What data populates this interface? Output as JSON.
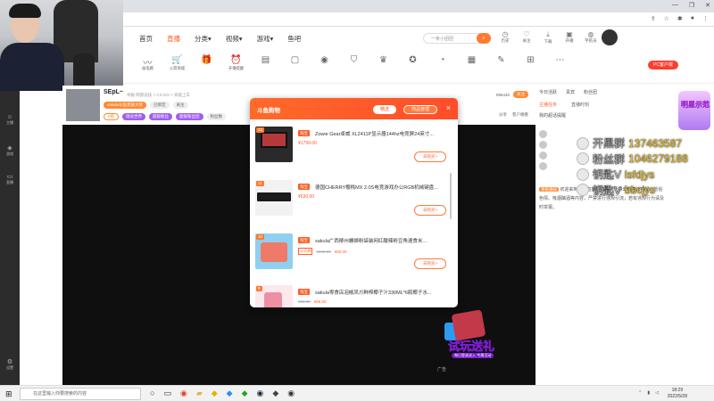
{
  "site_nav": {
    "items": [
      "首页",
      "直播",
      "分类▾",
      "视频▾",
      "游戏▾",
      "鱼吧"
    ],
    "active_index": 1,
    "search_placeholder": "一条小团团",
    "icons": [
      "历史",
      "关注",
      "下载",
      "开播",
      "宇航员"
    ]
  },
  "toolbar": {
    "tools": [
      "画电路",
      "火箭商城",
      "",
      "开播提醒",
      "",
      "",
      "",
      "",
      "",
      "",
      "",
      "",
      "",
      "",
      "",
      ""
    ],
    "pc_button": "PC客户端"
  },
  "streamer": {
    "name": "SEpL~",
    "crumbs": "举报  网游竞技 > CS:GO > 高能上车",
    "tags": [
      "sakula斗鱼贵族大奖",
      "已绑定",
      "关注"
    ],
    "chips": [
      "6级",
      "瑞龙世界",
      "超级粉丝",
      "超级粉丝团",
      "粉丝数"
    ],
    "right_info": [
      "896446",
      "关注"
    ],
    "right_actions": [
      "分享",
      "客户端看"
    ]
  },
  "modal": {
    "logo": "斗鱼购物",
    "btn_hot": "精选",
    "btn_manage": "商品管理",
    "close": "×",
    "items": [
      {
        "num": "12",
        "tag": "淘宝",
        "title": "Zowie Gear卓威 XL2411P显示器144hz电竞屏24英寸...",
        "price": "¥1799.00",
        "buy": "去购买>"
      },
      {
        "num": "11",
        "tag": "淘宝",
        "title": "德国CHERRY樱桃MX 2.0S电竞游戏办公RGB机械键盘...",
        "price": "¥530.00",
        "buy": "去购买>"
      },
      {
        "num": "10",
        "tag": "淘宝",
        "title": "sakula广西柳州螺蛳粉袋装网红酸辣粉豆角速食米...",
        "coupon": "10元券",
        "old": "¥100.00",
        "new": "¥90.00",
        "buy": "去购买>"
      },
      {
        "num": "9",
        "tag": "淘宝",
        "title": "sakula零食店泡椒凤爪鲜榨椰子汁330ML*6瓶椰子水...",
        "old": "¥68.00",
        "new": "¥58.00",
        "buy": "去购买>"
      }
    ]
  },
  "right_panel": {
    "head": [
      "今日活跃",
      "贵宾",
      "粉丝团"
    ],
    "tabs": [
      "主播任务",
      "直播时刻"
    ],
    "sub": "我的超话提醒",
    "notice_tag": "系统通知",
    "notice": "欢迎来到斗鱼直播！直播间严禁出现违法违规、低俗色情、吸烟酗酒等内容，严禁进行违规引流；若有违规行为请及时举报。"
  },
  "overlay": [
    {
      "label": "开黑群",
      "value": "137463587",
      "icon": "penguin-icon"
    },
    {
      "label": "粉丝群",
      "value": "1046279188",
      "icon": "group-icon"
    },
    {
      "label": "钥匙V",
      "value": "lsfdjys",
      "icon": "key-icon"
    },
    {
      "label": "钥匙V",
      "value": "bbcjys",
      "icon": "key-icon"
    }
  ],
  "promo": {
    "text": "试玩送礼",
    "sub": "每日登录送入·专属活动"
  },
  "player": {
    "ad_label": "广告"
  },
  "left_sidebar": [
    "主播",
    "游戏",
    "直播",
    "鱼吧",
    "设置"
  ],
  "taskbar": {
    "search_placeholder": "在这里输入你要搜索的内容",
    "time": "18:29",
    "date": "2022/5/28"
  },
  "float_badge": "明星示范",
  "colors": {
    "brand": "#ff5d23",
    "modal_header": "#ff6a2a",
    "player_bg": "#0f0f0f"
  }
}
